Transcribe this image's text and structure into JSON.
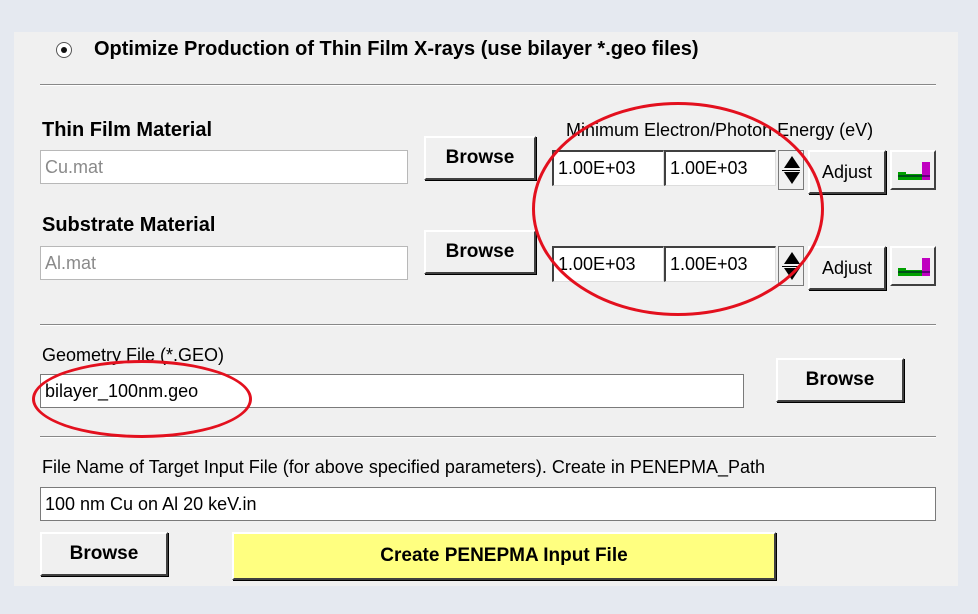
{
  "option": {
    "label": "Optimize Production of Thin Film X-rays (use bilayer *.geo files)",
    "selected": true
  },
  "energy_header": "Minimum Electron/Photon Energy (eV)",
  "thin_film": {
    "label": "Thin Film Material",
    "value": "Cu.mat",
    "browse": "Browse",
    "energy1": "1.00E+03",
    "energy2": "1.00E+03",
    "adjust": "Adjust"
  },
  "substrate": {
    "label": "Substrate Material",
    "value": "Al.mat",
    "browse": "Browse",
    "energy1": "1.00E+03",
    "energy2": "1.00E+03",
    "adjust": "Adjust"
  },
  "geometry": {
    "label": "Geometry File (*.GEO)",
    "value": "bilayer_100nm.geo",
    "browse": "Browse"
  },
  "target": {
    "label": "File Name of Target Input File (for above specified parameters). Create in PENEPMA_Path",
    "value": "100 nm Cu on Al 20 keV.in",
    "browse": "Browse",
    "create": "Create PENEPMA Input File"
  },
  "colors": {
    "annotation": "#e3101e",
    "create_button": "#ffff80",
    "panel": "#f0f0f0",
    "background": "#e5e9f0"
  },
  "icons": [
    "radio-selected-icon",
    "spin-arrows-icon",
    "periodic-table-icon"
  ]
}
